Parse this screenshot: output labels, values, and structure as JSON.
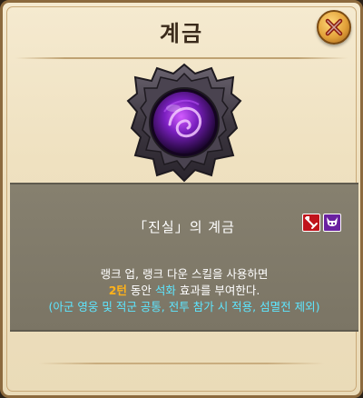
{
  "window": {
    "title": "계금",
    "close_icon": "close-x-icon"
  },
  "emblem": {
    "icon": "purple-orb-shield-icon"
  },
  "skill": {
    "name": "「진실」의 계금",
    "badges": [
      {
        "icon": "red-weapon-icon",
        "color": "#c0141c"
      },
      {
        "icon": "purple-demon-icon",
        "color": "#6a21a0"
      }
    ]
  },
  "description": {
    "line1": "랭크 업, 랭크 다운 스킬을 사용하면",
    "line2_turns": "2턴",
    "line2_mid": " 동안 ",
    "line2_effect": "석화",
    "line2_end": " 효과를 부여한다.",
    "line3": "(아군 영웅 및 적군 공통, 전투 참가 시 적용, 섬멸전 제외)"
  },
  "colors": {
    "highlight_turns": "#ffb21a",
    "highlight_effect": "#5ee6ff",
    "note": "#5ee6ff"
  }
}
